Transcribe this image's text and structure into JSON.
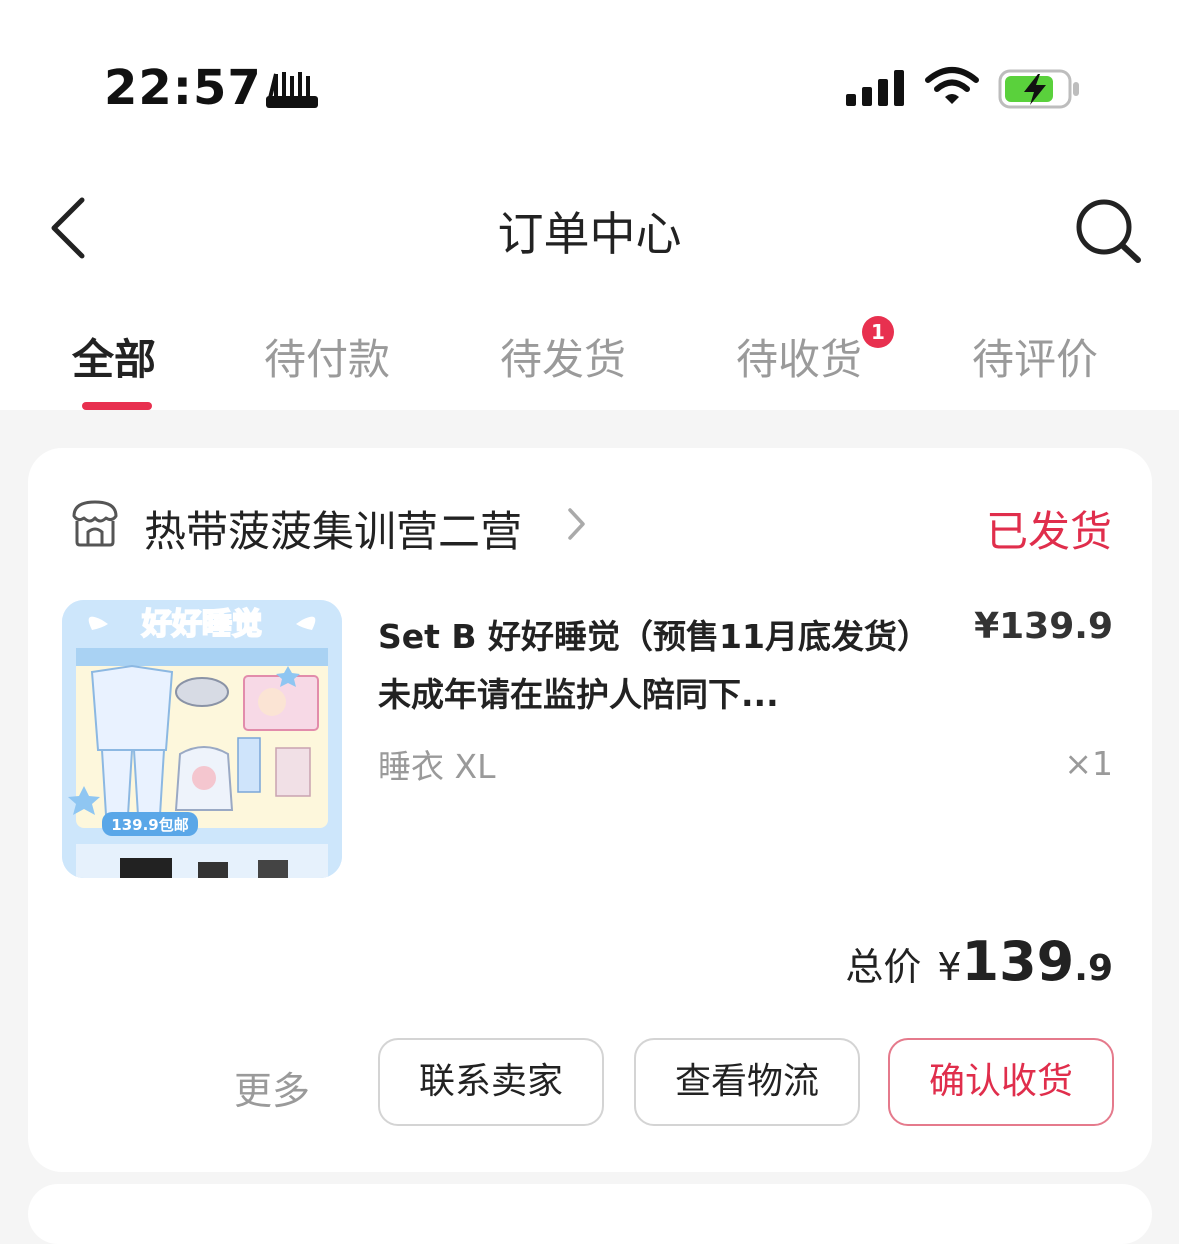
{
  "status_bar": {
    "time": "22:57",
    "carrier_badge_icon": "app-badge-icon",
    "signal_icon": "cellular-signal-icon",
    "wifi_icon": "wifi-icon",
    "battery_icon": "battery-charging-icon",
    "battery_color": "#5ad13c"
  },
  "header": {
    "title": "订单中心",
    "back_icon": "chevron-left-icon",
    "search_icon": "search-icon"
  },
  "tabs": [
    {
      "label": "全部",
      "active": true
    },
    {
      "label": "待付款"
    },
    {
      "label": "待发货"
    },
    {
      "label": "待收货",
      "badge": "1"
    },
    {
      "label": "待评价"
    }
  ],
  "colors": {
    "accent": "#e8304f",
    "status_text": "#e02e4c"
  },
  "order": {
    "shop_name": "热带菠菠集训营二营",
    "status": "已发货",
    "product": {
      "title": "Set B 好好睡觉（预售11月底发货）未成年请在监护人陪同下...",
      "price": "¥139.9",
      "variant": "睡衣 XL",
      "quantity": "×1",
      "image_texts": {
        "banner": "好好睡觉",
        "price_tag": "139.9包邮"
      }
    },
    "total": {
      "label": "总价",
      "currency": "¥",
      "integer": "139",
      "decimal": ".9"
    },
    "actions": {
      "more": "更多",
      "contact_seller": "联系卖家",
      "view_logistics": "查看物流",
      "confirm_receipt": "确认收货"
    }
  }
}
